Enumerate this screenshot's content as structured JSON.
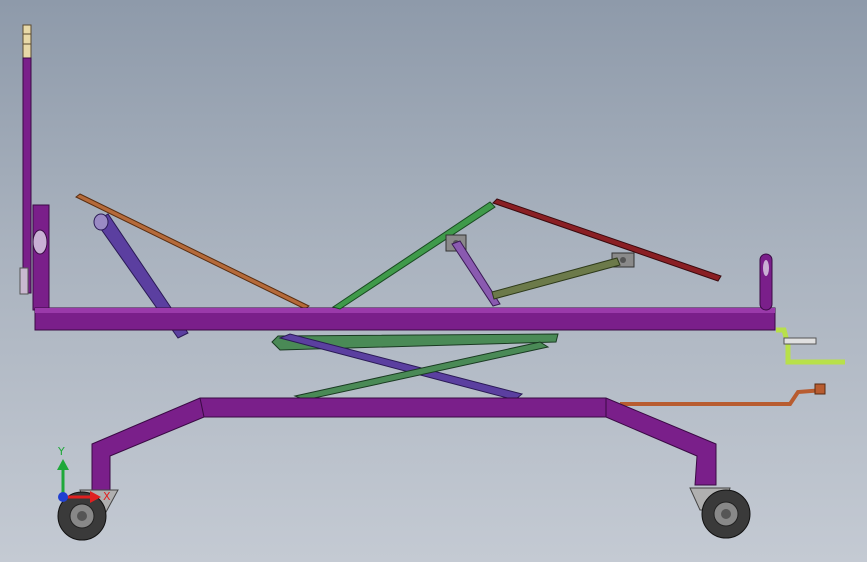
{
  "viewport": {
    "background_top": "#8e9aaa",
    "background_bottom": "#c4cad3"
  },
  "colors": {
    "frame": "#7a1f8a",
    "frame_dark": "#5a1466",
    "back_rest": "#b56a3a",
    "strut": "#5b3fa0",
    "knee": "#3f9a4a",
    "leg_rest": "#8a1f24",
    "linkage": "#6c7a4a",
    "scissor": "#4a8a56",
    "crank": "#b85c30",
    "handle": "#b8e04a",
    "wheel": "#444444",
    "bracket": "#b0b0b0"
  },
  "triad": {
    "y_label": "Y",
    "x_label": "X",
    "y_color": "#1fa83a",
    "x_color": "#e02020",
    "z_color": "#2040d0"
  },
  "icons": {
    "triad": "coordinate-triad-icon"
  }
}
